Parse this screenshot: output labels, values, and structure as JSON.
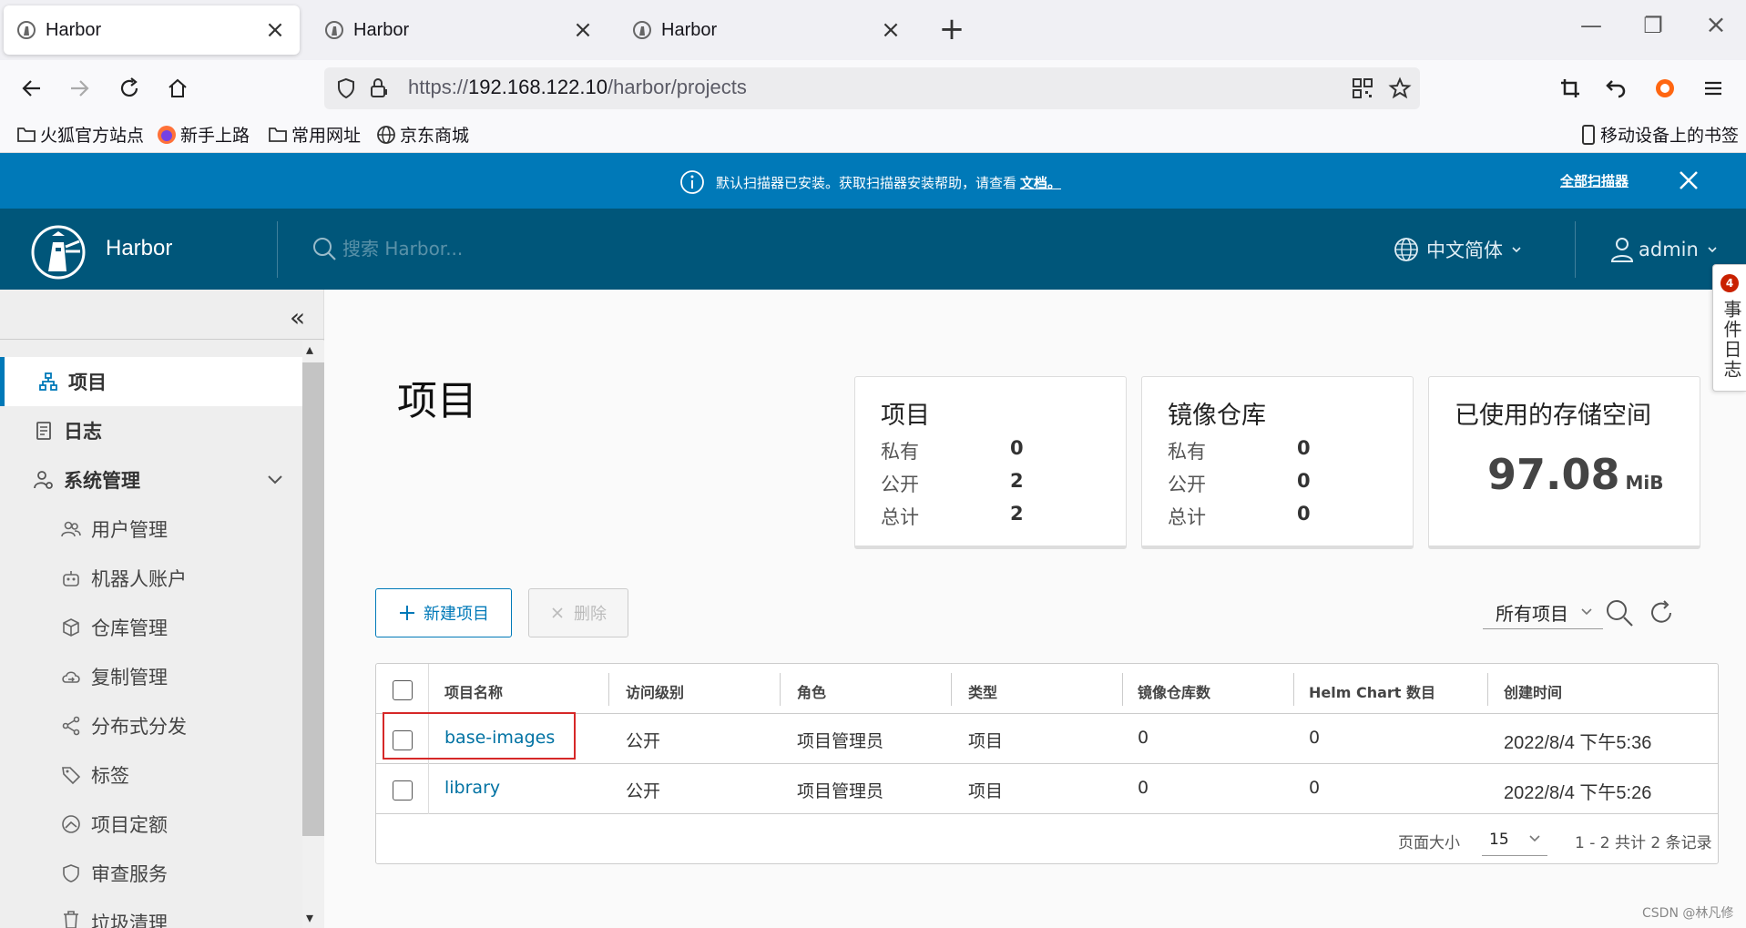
{
  "browser": {
    "tabs": [
      {
        "title": "Harbor",
        "active": true
      },
      {
        "title": "Harbor",
        "active": false
      },
      {
        "title": "Harbor",
        "active": false
      }
    ],
    "url_prefix": "https://",
    "url_host": "192.168.122.10",
    "url_path": "/harbor/projects",
    "bookmarks": [
      {
        "label": "火狐官方站点",
        "icon": "folder-icon"
      },
      {
        "label": "新手上路",
        "icon": "firefox-icon"
      },
      {
        "label": "常用网址",
        "icon": "folder-icon"
      },
      {
        "label": "京东商城",
        "icon": "globe-icon"
      }
    ],
    "mobile_bookmarks": "移动设备上的书签"
  },
  "banner": {
    "message": "默认扫描器已安装。获取扫描器安装帮助，请查看",
    "link": "文档。",
    "all_scanners": "全部扫描器",
    "color": "#0079b8"
  },
  "header": {
    "brand": "Harbor",
    "search_placeholder": "搜索 Harbor...",
    "language": "中文简体",
    "user": "admin",
    "color": "#00567a"
  },
  "sidebar": {
    "items": [
      {
        "label": "项目",
        "icon": "projects-icon",
        "active": true
      },
      {
        "label": "日志",
        "icon": "logs-icon"
      },
      {
        "label": "系统管理",
        "icon": "admin-icon",
        "expandable": true
      },
      {
        "label": "用户管理",
        "icon": "users-icon",
        "sub": true
      },
      {
        "label": "机器人账户",
        "icon": "robot-icon",
        "sub": true
      },
      {
        "label": "仓库管理",
        "icon": "registry-icon",
        "sub": true
      },
      {
        "label": "复制管理",
        "icon": "replication-icon",
        "sub": true
      },
      {
        "label": "分布式分发",
        "icon": "share-icon",
        "sub": true
      },
      {
        "label": "标签",
        "icon": "tag-icon",
        "sub": true
      },
      {
        "label": "项目定额",
        "icon": "quota-icon",
        "sub": true
      },
      {
        "label": "审查服务",
        "icon": "shield-icon",
        "sub": true
      },
      {
        "label": "垃圾清理",
        "icon": "trash-icon",
        "sub": true
      }
    ]
  },
  "main": {
    "title": "项目",
    "cards": {
      "projects": {
        "title": "项目",
        "rows": [
          {
            "k": "私有",
            "v": "0"
          },
          {
            "k": "公开",
            "v": "2"
          },
          {
            "k": "总计",
            "v": "2"
          }
        ]
      },
      "repos": {
        "title": "镜像仓库",
        "rows": [
          {
            "k": "私有",
            "v": "0"
          },
          {
            "k": "公开",
            "v": "0"
          },
          {
            "k": "总计",
            "v": "0"
          }
        ]
      },
      "storage": {
        "title": "已使用的存储空间",
        "value": "97.08",
        "unit": "MiB"
      }
    },
    "new_button": "新建项目",
    "delete_button": "删除",
    "filter": "所有项目",
    "table": {
      "headers": [
        "项目名称",
        "访问级别",
        "角色",
        "类型",
        "镜像仓库数",
        "Helm Chart 数目",
        "创建时间"
      ],
      "rows": [
        {
          "name": "base-images",
          "access": "公开",
          "role": "项目管理员",
          "type": "项目",
          "repos": "0",
          "charts": "0",
          "created": "2022/8/4 下午5:36"
        },
        {
          "name": "library",
          "access": "公开",
          "role": "项目管理员",
          "type": "项目",
          "repos": "0",
          "charts": "0",
          "created": "2022/8/4 下午5:26"
        }
      ],
      "page_size_label": "页面大小",
      "page_size": "15",
      "summary": "1 - 2 共计 2 条记录"
    }
  },
  "event_tab": {
    "label": "事件日志",
    "count": "4"
  },
  "watermark": "CSDN @林凡修"
}
